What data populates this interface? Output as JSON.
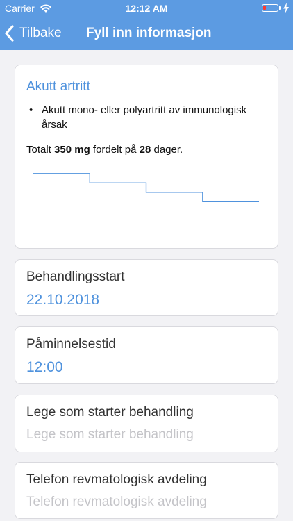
{
  "status_bar": {
    "carrier": "Carrier",
    "time": "12:12 AM"
  },
  "nav": {
    "back_label": "Tilbake",
    "title": "Fyll inn informasjon"
  },
  "indication": {
    "title": "Akutt artritt",
    "bullets": [
      "Akutt mono- eller polyartritt av immunologisk årsak"
    ],
    "summary": {
      "prefix": "Totalt",
      "amount": "350 mg",
      "middle": "fordelt på",
      "days": "28",
      "suffix": "dager."
    }
  },
  "chart_data": {
    "type": "line",
    "title": "",
    "xlabel": "",
    "ylabel": "",
    "x": [
      0,
      7,
      7,
      14,
      14,
      21,
      21,
      28
    ],
    "y": [
      4,
      4,
      3,
      3,
      2,
      2,
      1,
      1
    ],
    "xlim": [
      0,
      28
    ],
    "ylim": [
      0,
      4.5
    ],
    "grid": false,
    "color": "#4f92dd"
  },
  "fields": {
    "start": {
      "label": "Behandlingsstart",
      "value": "22.10.2018"
    },
    "reminder": {
      "label": "Påminnelsestid",
      "value": "12:00"
    },
    "doctor": {
      "label": "Lege som starter behandling",
      "placeholder": "Lege som starter behandling"
    },
    "phone": {
      "label": "Telefon revmatologisk avdeling",
      "placeholder": "Telefon revmatologisk avdeling"
    }
  },
  "colors": {
    "accent": "#5c9be2",
    "link": "#4f92dd",
    "battery_low": "#ff3b30"
  },
  "icons": {
    "wifi": "wifi-icon",
    "battery": "battery-icon",
    "charging": "charging-bolt-icon",
    "back": "chevron-left-icon"
  },
  "battery_level": 0.2
}
